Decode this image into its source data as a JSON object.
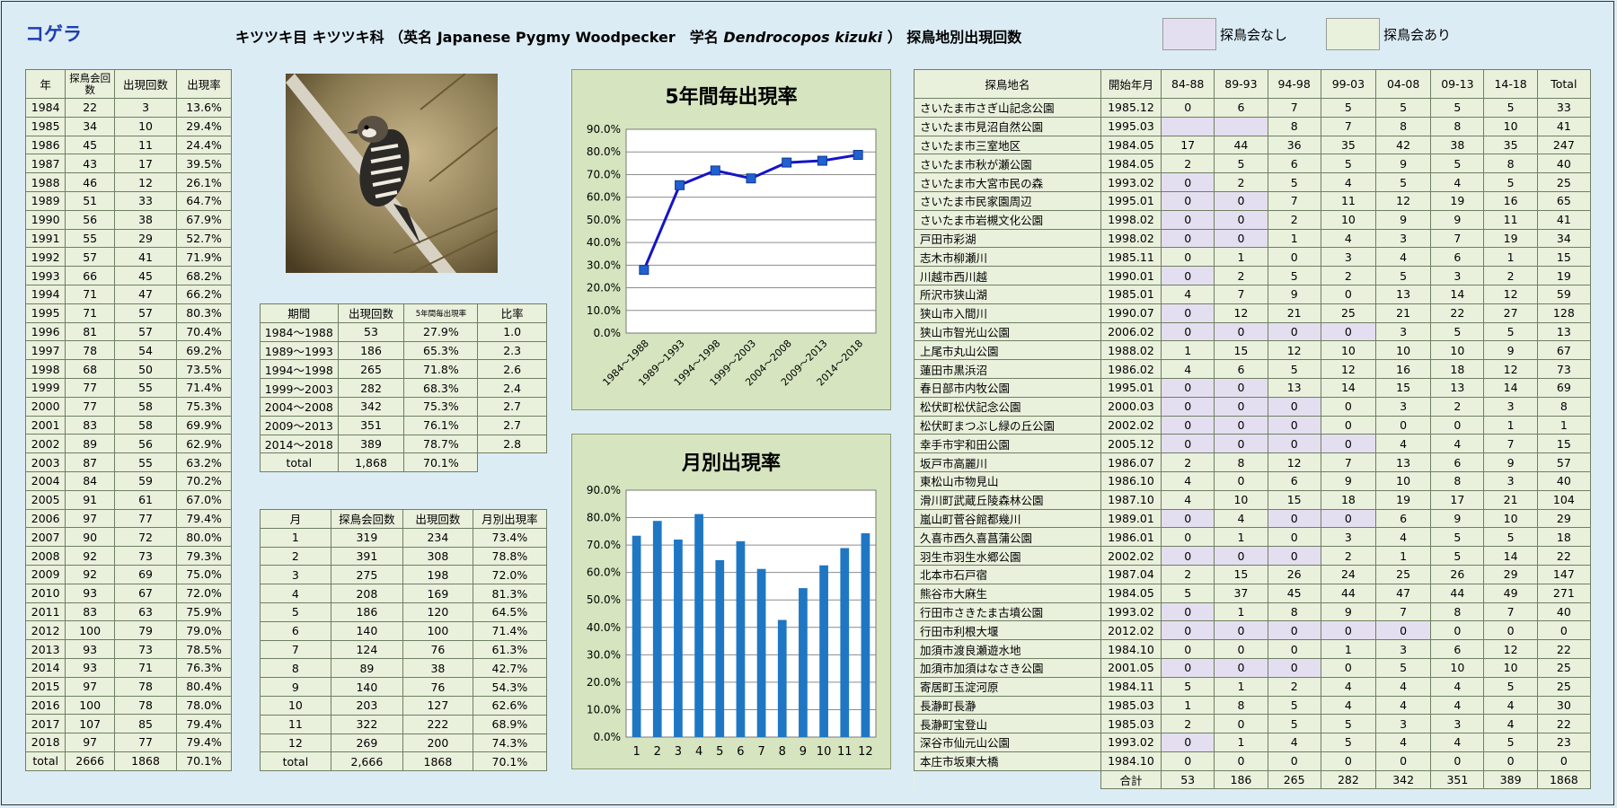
{
  "header": {
    "species": "コゲラ",
    "part1": "キツツキ目 キツツキ科 （英名 Japanese Pygmy Woodpecker　学名 ",
    "sci": "Dendrocopos kizuki",
    "part2": " ） 探鳥地別出現回数",
    "legend_none": "探鳥会なし",
    "legend_yes": "探鳥会あり"
  },
  "colors": {
    "none": "#e4dff0",
    "yes": "#e9f0dc",
    "line": "#1414c8",
    "marker": "#2060d0",
    "bar": "#1f77c4",
    "panel": "#d6e4bf"
  },
  "photo": {
    "alt": "woodpecker-photo"
  },
  "yearly": {
    "headers": [
      "年",
      "探鳥会回数",
      "出現回数",
      "出現率"
    ],
    "rows": [
      [
        "1984",
        "22",
        "3",
        "13.6%"
      ],
      [
        "1985",
        "34",
        "10",
        "29.4%"
      ],
      [
        "1986",
        "45",
        "11",
        "24.4%"
      ],
      [
        "1987",
        "43",
        "17",
        "39.5%"
      ],
      [
        "1988",
        "46",
        "12",
        "26.1%"
      ],
      [
        "1989",
        "51",
        "33",
        "64.7%"
      ],
      [
        "1990",
        "56",
        "38",
        "67.9%"
      ],
      [
        "1991",
        "55",
        "29",
        "52.7%"
      ],
      [
        "1992",
        "57",
        "41",
        "71.9%"
      ],
      [
        "1993",
        "66",
        "45",
        "68.2%"
      ],
      [
        "1994",
        "71",
        "47",
        "66.2%"
      ],
      [
        "1995",
        "71",
        "57",
        "80.3%"
      ],
      [
        "1996",
        "81",
        "57",
        "70.4%"
      ],
      [
        "1997",
        "78",
        "54",
        "69.2%"
      ],
      [
        "1998",
        "68",
        "50",
        "73.5%"
      ],
      [
        "1999",
        "77",
        "55",
        "71.4%"
      ],
      [
        "2000",
        "77",
        "58",
        "75.3%"
      ],
      [
        "2001",
        "83",
        "58",
        "69.9%"
      ],
      [
        "2002",
        "89",
        "56",
        "62.9%"
      ],
      [
        "2003",
        "87",
        "55",
        "63.2%"
      ],
      [
        "2004",
        "84",
        "59",
        "70.2%"
      ],
      [
        "2005",
        "91",
        "61",
        "67.0%"
      ],
      [
        "2006",
        "97",
        "77",
        "79.4%"
      ],
      [
        "2007",
        "90",
        "72",
        "80.0%"
      ],
      [
        "2008",
        "92",
        "73",
        "79.3%"
      ],
      [
        "2009",
        "92",
        "69",
        "75.0%"
      ],
      [
        "2010",
        "93",
        "67",
        "72.0%"
      ],
      [
        "2011",
        "83",
        "63",
        "75.9%"
      ],
      [
        "2012",
        "100",
        "79",
        "79.0%"
      ],
      [
        "2013",
        "93",
        "73",
        "78.5%"
      ],
      [
        "2014",
        "93",
        "71",
        "76.3%"
      ],
      [
        "2015",
        "97",
        "78",
        "80.4%"
      ],
      [
        "2016",
        "100",
        "78",
        "78.0%"
      ],
      [
        "2017",
        "107",
        "85",
        "79.4%"
      ],
      [
        "2018",
        "97",
        "77",
        "79.4%"
      ],
      [
        "total",
        "2666",
        "1868",
        "70.1%"
      ]
    ]
  },
  "period": {
    "headers": [
      "期間",
      "出現回数",
      "5年間毎出現率",
      "比率"
    ],
    "rows": [
      [
        "1984～1988",
        "53",
        "27.9%",
        "1.0"
      ],
      [
        "1989～1993",
        "186",
        "65.3%",
        "2.3"
      ],
      [
        "1994～1998",
        "265",
        "71.8%",
        "2.6"
      ],
      [
        "1999～2003",
        "282",
        "68.3%",
        "2.4"
      ],
      [
        "2004～2008",
        "342",
        "75.3%",
        "2.7"
      ],
      [
        "2009～2013",
        "351",
        "76.1%",
        "2.7"
      ],
      [
        "2014～2018",
        "389",
        "78.7%",
        "2.8"
      ]
    ],
    "total": [
      "total",
      "1,868",
      "70.1%"
    ]
  },
  "monthly": {
    "headers": [
      "月",
      "探鳥会回数",
      "出現回数",
      "月別出現率"
    ],
    "rows": [
      [
        "1",
        "319",
        "234",
        "73.4%"
      ],
      [
        "2",
        "391",
        "308",
        "78.8%"
      ],
      [
        "3",
        "275",
        "198",
        "72.0%"
      ],
      [
        "4",
        "208",
        "169",
        "81.3%"
      ],
      [
        "5",
        "186",
        "120",
        "64.5%"
      ],
      [
        "6",
        "140",
        "100",
        "71.4%"
      ],
      [
        "7",
        "124",
        "76",
        "61.3%"
      ],
      [
        "8",
        "89",
        "38",
        "42.7%"
      ],
      [
        "9",
        "140",
        "76",
        "54.3%"
      ],
      [
        "10",
        "203",
        "127",
        "62.6%"
      ],
      [
        "11",
        "322",
        "222",
        "68.9%"
      ],
      [
        "12",
        "269",
        "200",
        "74.3%"
      ],
      [
        "total",
        "2,666",
        "1868",
        "70.1%"
      ]
    ]
  },
  "chart_data": [
    {
      "type": "line",
      "title": "5年間毎出現率",
      "categories": [
        "1984～1988",
        "1989～1993",
        "1994～1998",
        "1999～2003",
        "2004～2008",
        "2009～2013",
        "2014～2018"
      ],
      "values": [
        27.9,
        65.3,
        71.8,
        68.3,
        75.3,
        76.1,
        78.7
      ],
      "ylim": [
        0,
        90
      ],
      "yticks": [
        "0.0%",
        "10.0%",
        "20.0%",
        "30.0%",
        "40.0%",
        "50.0%",
        "60.0%",
        "70.0%",
        "80.0%",
        "90.0%"
      ],
      "grid": true
    },
    {
      "type": "bar",
      "title": "月別出現率",
      "categories": [
        "1",
        "2",
        "3",
        "4",
        "5",
        "6",
        "7",
        "8",
        "9",
        "10",
        "11",
        "12"
      ],
      "values": [
        73.4,
        78.8,
        72.0,
        81.3,
        64.5,
        71.4,
        61.3,
        42.7,
        54.3,
        62.6,
        68.9,
        74.3
      ],
      "ylim": [
        0,
        90
      ],
      "yticks": [
        "0.0%",
        "10.0%",
        "20.0%",
        "30.0%",
        "40.0%",
        "50.0%",
        "60.0%",
        "70.0%",
        "80.0%",
        "90.0%"
      ],
      "grid": true
    }
  ],
  "sites": {
    "headers": [
      "探鳥地名",
      "開始年月",
      "84-88",
      "89-93",
      "94-98",
      "99-03",
      "04-08",
      "09-13",
      "14-18",
      "Total"
    ],
    "rows": [
      {
        "name": "さいたま市さぎ山記念公園",
        "start": "1985.12",
        "v": [
          "0",
          "6",
          "7",
          "5",
          "5",
          "5",
          "5",
          "33"
        ],
        "none": []
      },
      {
        "name": "さいたま市見沼自然公園",
        "start": "1995.03",
        "v": [
          "",
          "",
          "8",
          "7",
          "8",
          "8",
          "10",
          "41"
        ],
        "none": [
          0,
          1
        ]
      },
      {
        "name": "さいたま市三室地区",
        "start": "1984.05",
        "v": [
          "17",
          "44",
          "36",
          "35",
          "42",
          "38",
          "35",
          "247"
        ],
        "none": []
      },
      {
        "name": "さいたま市秋が瀬公園",
        "start": "1984.05",
        "v": [
          "2",
          "5",
          "6",
          "5",
          "9",
          "5",
          "8",
          "40"
        ],
        "none": []
      },
      {
        "name": "さいたま市大宮市民の森",
        "start": "1993.02",
        "v": [
          "0",
          "2",
          "5",
          "4",
          "5",
          "4",
          "5",
          "25"
        ],
        "none": [
          0
        ]
      },
      {
        "name": "さいたま市民家園周辺",
        "start": "1995.01",
        "v": [
          "0",
          "0",
          "7",
          "11",
          "12",
          "19",
          "16",
          "65"
        ],
        "none": [
          0,
          1
        ]
      },
      {
        "name": "さいたま市岩槻文化公園",
        "start": "1998.02",
        "v": [
          "0",
          "0",
          "2",
          "10",
          "9",
          "9",
          "11",
          "41"
        ],
        "none": [
          0,
          1
        ]
      },
      {
        "name": "戸田市彩湖",
        "start": "1998.02",
        "v": [
          "0",
          "0",
          "1",
          "4",
          "3",
          "7",
          "19",
          "34"
        ],
        "none": [
          0,
          1
        ]
      },
      {
        "name": "志木市柳瀬川",
        "start": "1985.11",
        "v": [
          "0",
          "1",
          "0",
          "3",
          "4",
          "6",
          "1",
          "15"
        ],
        "none": []
      },
      {
        "name": "川越市西川越",
        "start": "1990.01",
        "v": [
          "0",
          "2",
          "5",
          "2",
          "5",
          "3",
          "2",
          "19"
        ],
        "none": [
          0
        ]
      },
      {
        "name": "所沢市狭山湖",
        "start": "1985.01",
        "v": [
          "4",
          "7",
          "9",
          "0",
          "13",
          "14",
          "12",
          "59"
        ],
        "none": []
      },
      {
        "name": "狭山市入間川",
        "start": "1990.07",
        "v": [
          "0",
          "12",
          "21",
          "25",
          "21",
          "22",
          "27",
          "128"
        ],
        "none": [
          0
        ]
      },
      {
        "name": "狭山市智光山公園",
        "start": "2006.02",
        "v": [
          "0",
          "0",
          "0",
          "0",
          "3",
          "5",
          "5",
          "13"
        ],
        "none": [
          0,
          1,
          2,
          3
        ]
      },
      {
        "name": "上尾市丸山公園",
        "start": "1988.02",
        "v": [
          "1",
          "15",
          "12",
          "10",
          "10",
          "10",
          "9",
          "67"
        ],
        "none": []
      },
      {
        "name": "蓮田市黒浜沼",
        "start": "1986.02",
        "v": [
          "4",
          "6",
          "5",
          "12",
          "16",
          "18",
          "12",
          "73"
        ],
        "none": []
      },
      {
        "name": "春日部市内牧公園",
        "start": "1995.01",
        "v": [
          "0",
          "0",
          "13",
          "14",
          "15",
          "13",
          "14",
          "69"
        ],
        "none": [
          0,
          1
        ]
      },
      {
        "name": "松伏町松伏記念公園",
        "start": "2000.03",
        "v": [
          "0",
          "0",
          "0",
          "0",
          "3",
          "2",
          "3",
          "8"
        ],
        "none": [
          0,
          1,
          2
        ]
      },
      {
        "name": "松伏町まつぶし緑の丘公園",
        "start": "2002.02",
        "v": [
          "0",
          "0",
          "0",
          "0",
          "0",
          "0",
          "1",
          "1"
        ],
        "none": [
          0,
          1,
          2
        ]
      },
      {
        "name": "幸手市宇和田公園",
        "start": "2005.12",
        "v": [
          "0",
          "0",
          "0",
          "0",
          "4",
          "4",
          "7",
          "15"
        ],
        "none": [
          0,
          1,
          2,
          3
        ]
      },
      {
        "name": "坂戸市高麗川",
        "start": "1986.07",
        "v": [
          "2",
          "8",
          "12",
          "7",
          "13",
          "6",
          "9",
          "57"
        ],
        "none": []
      },
      {
        "name": "東松山市物見山",
        "start": "1986.10",
        "v": [
          "4",
          "0",
          "6",
          "9",
          "10",
          "8",
          "3",
          "40"
        ],
        "none": []
      },
      {
        "name": "滑川町武蔵丘陵森林公園",
        "start": "1987.10",
        "v": [
          "4",
          "10",
          "15",
          "18",
          "19",
          "17",
          "21",
          "104"
        ],
        "none": []
      },
      {
        "name": "嵐山町菅谷館都幾川",
        "start": "1989.01",
        "v": [
          "0",
          "4",
          "0",
          "0",
          "6",
          "9",
          "10",
          "29"
        ],
        "none": [
          0,
          2,
          3
        ]
      },
      {
        "name": "久喜市西久喜菖蒲公園",
        "start": "1986.01",
        "v": [
          "0",
          "1",
          "0",
          "3",
          "4",
          "5",
          "5",
          "18"
        ],
        "none": []
      },
      {
        "name": "羽生市羽生水郷公園",
        "start": "2002.02",
        "v": [
          "0",
          "0",
          "0",
          "2",
          "1",
          "5",
          "14",
          "22"
        ],
        "none": [
          0,
          1,
          2
        ]
      },
      {
        "name": "北本市石戸宿",
        "start": "1987.04",
        "v": [
          "2",
          "15",
          "26",
          "24",
          "25",
          "26",
          "29",
          "147"
        ],
        "none": []
      },
      {
        "name": "熊谷市大麻生",
        "start": "1984.05",
        "v": [
          "5",
          "37",
          "45",
          "44",
          "47",
          "44",
          "49",
          "271"
        ],
        "none": []
      },
      {
        "name": "行田市さきたま古墳公園",
        "start": "1993.02",
        "v": [
          "0",
          "1",
          "8",
          "9",
          "7",
          "8",
          "7",
          "40"
        ],
        "none": [
          0
        ]
      },
      {
        "name": "行田市利根大堰",
        "start": "2012.02",
        "v": [
          "0",
          "0",
          "0",
          "0",
          "0",
          "0",
          "0",
          "0"
        ],
        "none": [
          0,
          1,
          2,
          3,
          4
        ]
      },
      {
        "name": "加須市渡良瀬遊水地",
        "start": "1984.10",
        "v": [
          "0",
          "0",
          "0",
          "1",
          "3",
          "6",
          "12",
          "22"
        ],
        "none": []
      },
      {
        "name": "加須市加須はなさき公園",
        "start": "2001.05",
        "v": [
          "0",
          "0",
          "0",
          "0",
          "5",
          "10",
          "10",
          "25"
        ],
        "none": [
          0,
          1,
          2
        ]
      },
      {
        "name": "寄居町玉淀河原",
        "start": "1984.11",
        "v": [
          "5",
          "1",
          "2",
          "4",
          "4",
          "4",
          "5",
          "25"
        ],
        "none": []
      },
      {
        "name": "長瀞町長瀞",
        "start": "1985.03",
        "v": [
          "1",
          "8",
          "5",
          "4",
          "4",
          "4",
          "4",
          "30"
        ],
        "none": []
      },
      {
        "name": "長瀞町宝登山",
        "start": "1985.03",
        "v": [
          "2",
          "0",
          "5",
          "5",
          "3",
          "3",
          "4",
          "22"
        ],
        "none": []
      },
      {
        "name": "深谷市仙元山公園",
        "start": "1993.02",
        "v": [
          "0",
          "1",
          "4",
          "5",
          "4",
          "4",
          "5",
          "23"
        ],
        "none": [
          0
        ]
      },
      {
        "name": "本庄市坂東大橋",
        "start": "1984.10",
        "v": [
          "0",
          "0",
          "0",
          "0",
          "0",
          "0",
          "0",
          "0"
        ],
        "none": []
      }
    ],
    "total_label": "合計",
    "totals": [
      "53",
      "186",
      "265",
      "282",
      "342",
      "351",
      "389",
      "1868"
    ]
  }
}
